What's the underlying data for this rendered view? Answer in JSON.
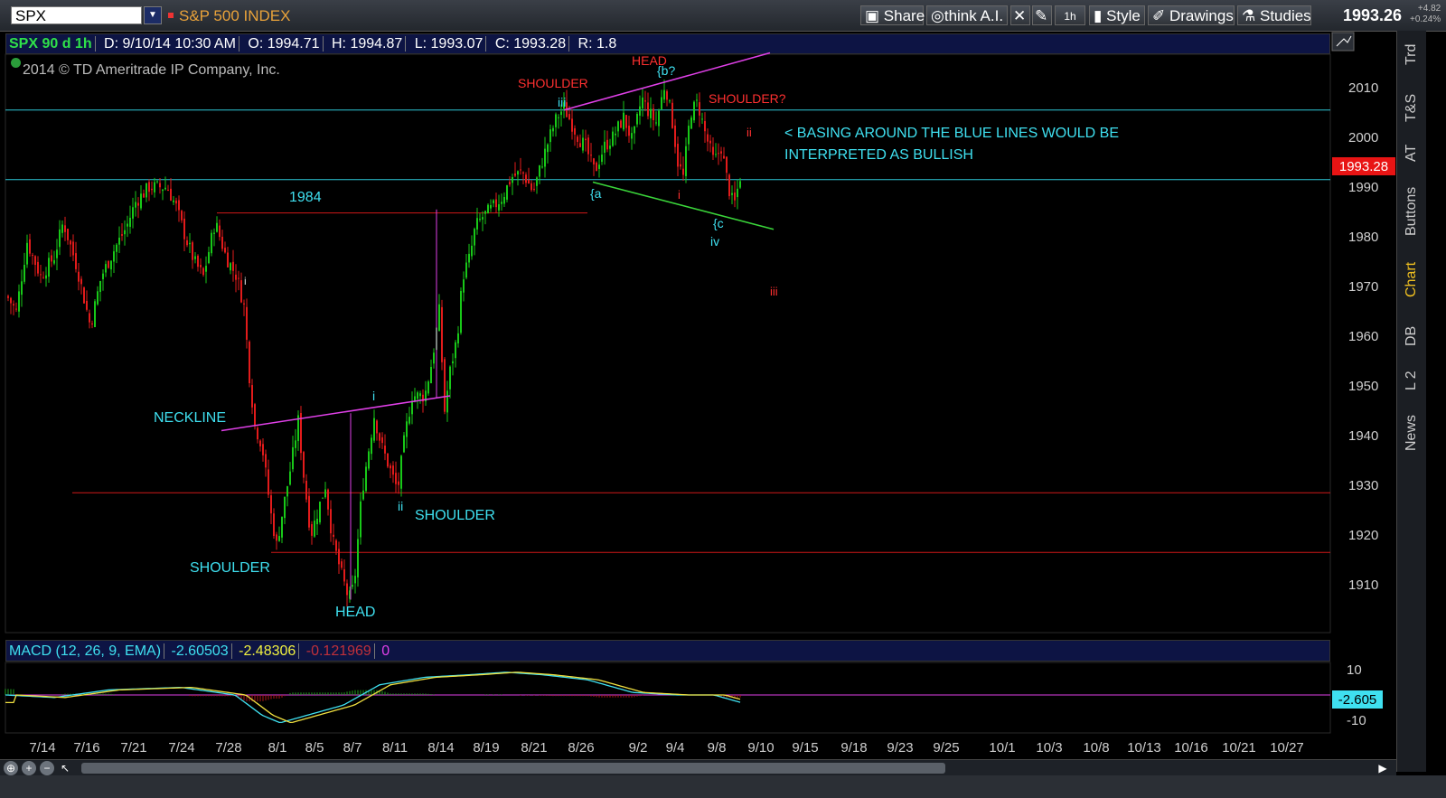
{
  "toolbar": {
    "symbol": "SPX",
    "index_name": "S&P 500 INDEX",
    "share": "Share",
    "think_ai": "think A.I.",
    "interval": "1h",
    "style": "Style",
    "drawings": "Drawings",
    "studies": "Studies",
    "last_price": "1993.26",
    "change": "+4.82",
    "change_pct": "+0.24%"
  },
  "info_bar": {
    "title": "SPX 90 d 1h",
    "date": "D: 9/10/14 10:30 AM",
    "open": "O: 1994.71",
    "high": "H: 1994.87",
    "low": "L: 1993.07",
    "close": "C: 1993.28",
    "range": "R: 1.8"
  },
  "copyright": "2014 © TD Ameritrade IP Company, Inc.",
  "side_tabs": [
    "Trd",
    "T&S",
    "AT",
    "Buttons",
    "Chart",
    "DB",
    "L 2",
    "News"
  ],
  "colors": {
    "up": "#18c818",
    "down": "#e21b1b",
    "cyan": "#3fe0f0",
    "magenta": "#e040e8",
    "green_line": "#3ad53a",
    "red_label": "#ff3030",
    "price_tag": "#e81414"
  },
  "macd_bar": {
    "label": "MACD (12, 26, 9, EMA)",
    "value": "-2.60503",
    "avg": "-2.48306",
    "diff": "-0.121969",
    "zero": "0",
    "current": "-2.605"
  },
  "chart_data": [
    {
      "type": "candlestick",
      "ylim": [
        1902,
        2017
      ],
      "yticks": [
        1910,
        1920,
        1930,
        1940,
        1950,
        1960,
        1970,
        1980,
        1990,
        2000,
        2010
      ],
      "x_tick_labels": [
        "7/14",
        "7/16",
        "7/21",
        "7/24",
        "7/28",
        "8/1",
        "8/5",
        "8/7",
        "8/11",
        "8/14",
        "8/19",
        "8/21",
        "8/26",
        "9/2",
        "9/4",
        "9/8",
        "9/10",
        "9/15",
        "9/18",
        "9/23",
        "9/25",
        "10/1",
        "10/3",
        "10/8",
        "10/13",
        "10/16",
        "10/21",
        "10/27"
      ],
      "current_price": "1993.28",
      "horizontal_lines": [
        {
          "y": 2005.5,
          "color": "cyan"
        },
        {
          "y": 1991.5,
          "color": "cyan"
        },
        {
          "y": 1984.8,
          "color": "red",
          "label": "1984"
        },
        {
          "y": 1928.5,
          "color": "red"
        },
        {
          "y": 1916.5,
          "color": "red"
        }
      ],
      "annotations": [
        {
          "text": "NECKLINE",
          "color": "cyan"
        },
        {
          "text": "SHOULDER",
          "color": "cyan"
        },
        {
          "text": "HEAD",
          "color": "cyan"
        },
        {
          "text": "SHOULDER",
          "color": "cyan"
        },
        {
          "text": "i",
          "color": "cyan"
        },
        {
          "text": "ii",
          "color": "cyan"
        },
        {
          "text": "iii",
          "color": "cyan"
        },
        {
          "text": "{a",
          "color": "cyan"
        },
        {
          "text": "{b?",
          "color": "cyan"
        },
        {
          "text": "{c",
          "color": "cyan"
        },
        {
          "text": "iv",
          "color": "cyan"
        },
        {
          "text": "SHOULDER",
          "color": "red"
        },
        {
          "text": "HEAD",
          "color": "red"
        },
        {
          "text": "SHOULDER?",
          "color": "red"
        },
        {
          "text": "i",
          "color": "red"
        },
        {
          "text": "ii",
          "color": "red"
        },
        {
          "text": "iii",
          "color": "red"
        },
        {
          "text": "i",
          "color": "white"
        },
        {
          "text": "< BASING AROUND THE BLUE LINES WOULD BE",
          "color": "cyan"
        },
        {
          "text": "INTERPRETED AS BULLISH",
          "color": "cyan"
        }
      ]
    },
    {
      "type": "line",
      "yticks": [
        10,
        -10
      ],
      "series": [
        {
          "values": []
        }
      ]
    }
  ]
}
